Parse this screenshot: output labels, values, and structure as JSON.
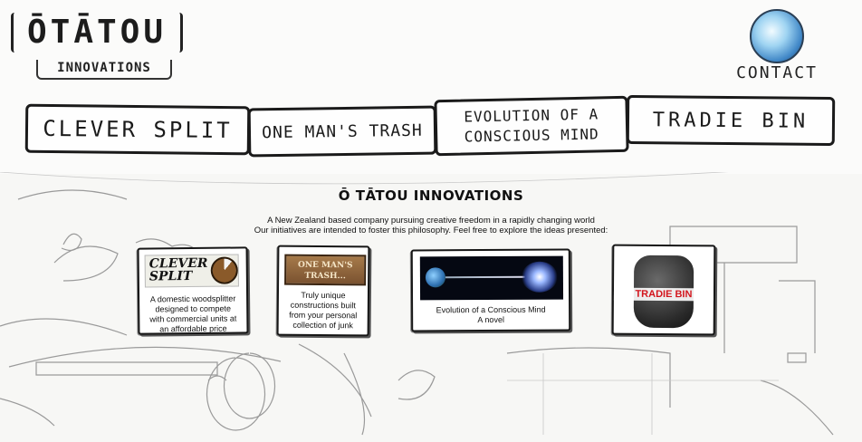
{
  "logo": {
    "main": "ŌTĀTOU",
    "sub": "INNOVATIONS"
  },
  "contact": {
    "label": "CONTACT"
  },
  "nav": {
    "items": [
      {
        "label": "CLEVER SPLIT"
      },
      {
        "label": "ONE MAN'S TRASH"
      },
      {
        "label_line1": "EVOLUTION OF A",
        "label_line2": "CONSCIOUS MIND"
      },
      {
        "label": "TRADIE BIN"
      }
    ]
  },
  "main": {
    "title": "Ō TĀTOU INNOVATIONS",
    "intro_line1": "A New Zealand based company pursuing creative freedom in a rapidly changing world",
    "intro_line2": "Our initiatives are intended to foster this philosophy. Feel free to explore the ideas presented:"
  },
  "cards": {
    "clever_split": {
      "logo_text_1": "CLEVER",
      "logo_text_2": "SPLIT",
      "caption": [
        "A domestic woodsplitter",
        "designed to compete",
        "with commercial units at",
        "an affordable price"
      ]
    },
    "one_mans_trash": {
      "logo_text_1": "ONE MAN'S",
      "logo_text_2": "TRASH...",
      "caption": [
        "Truly unique",
        "constructions built",
        "from your personal",
        "collection of junk"
      ]
    },
    "evolution": {
      "caption": [
        "Evolution of a Conscious Mind",
        "A novel"
      ]
    },
    "tradie_bin": {
      "logo_text": "TRADIE BIN"
    }
  }
}
